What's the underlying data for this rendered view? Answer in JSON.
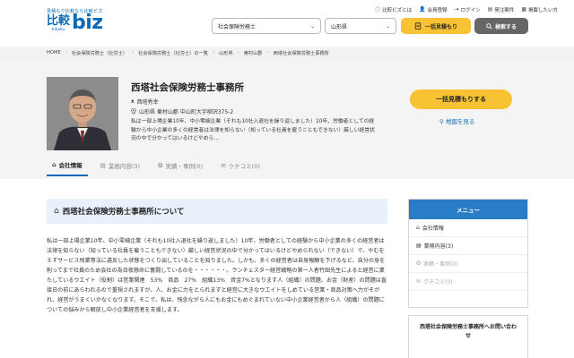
{
  "header": {
    "tagline": "見積もり比較なら比較ビズ",
    "logo_kanji": "比較",
    "logo_roman": "hikaku",
    "logo_biz": "biz",
    "links": [
      {
        "label": "比較ビズとは"
      },
      {
        "label": "会員登録"
      },
      {
        "label": "ログイン"
      },
      {
        "label": "発注案件"
      },
      {
        "label": "掲載したい方"
      }
    ],
    "service_select": "社会保険労務士",
    "pref_select": "山形県",
    "quote_button": "一括見積もり",
    "search_button": "検索する"
  },
  "breadcrumb": [
    "HOME",
    "社会保険労務士（社労士）",
    "社会保険労務士（社労士）の一覧",
    "山形県",
    "東村山郡",
    "西塔社会保険労務士事務所"
  ],
  "profile": {
    "company_name": "西塔社会保険労務士事務所",
    "representative": "西塔秀幸",
    "address": "山形県 東村山郡 中山町大字柳沢375-2",
    "description": "私は一部上場企業10年、中小零細企業（それも10社入退社を繰り返しました）10年、労働者としての経験から中小企業の多くの経営者は法律を知らない（知っている社員を雇うこともできない）厳しい経営状況の中で分かってはいるけどやめら…",
    "quote_button": "一括見積もりする",
    "map_link": "地図を見る"
  },
  "tabs": [
    {
      "label": "会社情報",
      "active": true
    },
    {
      "label": "業務内容(3)",
      "active": false
    },
    {
      "label": "実績・事例(0)",
      "active": false
    },
    {
      "label": "クチコミ(0)",
      "active": false
    }
  ],
  "main": {
    "section_title": "西塔社会保険労務士事務所について",
    "body": "私は一部上場企業10年、中小零細企業（それも10社入退社を繰り返しました）10年、労働者としての経験から中小企業の多くの経営者は法律を知らない（知っている社員を雇うこともできない）厳しい経営状況の中で分かってはいるけどやめられない（できない）で、やむをえずサービス残業等法に違反した状態をつくり出していることを知りました。しかも、多くの経営者は自身報酬を下げるなど、自分の身を削ってまで社員のため会社の為日夜懸命に奮闘しているのを・・・・・・。ランチェスター経営戦略の第一人者竹田先生によると経営に業たしているウエイト（役割）は営業関連　53%　商品　27%　組織13%　資金7%となります人（組織）の問題、お金（財産）の問題は直接日の前にあらわれるので重視されますが、人、お金に力をとられますと経営に大きなウエイトをしめている営業・商品対策へ力がそがれ、経営がうまくいかなくなります。そこで、私は、残念ながら人にもお金にもめぐまれていない中小企業経営者から人（組織）の問題についての悩みから解放し中小企業経営者を支援します。"
  },
  "sidebar": {
    "menu_title": "メニュー",
    "items": [
      {
        "label": "会社情報",
        "dim": false
      },
      {
        "label": "業務内容(3)",
        "dim": false
      },
      {
        "label": "実績・事例(0)",
        "dim": true
      },
      {
        "label": "クチコミ(0)",
        "dim": true
      }
    ],
    "contact_title": "西塔社会保険労務士事務所へお問い合わせ"
  },
  "colors": {
    "brand_blue": "#0a6ab8",
    "accent_yellow": "#f7c233",
    "menu_blue": "#2a7cc7"
  }
}
